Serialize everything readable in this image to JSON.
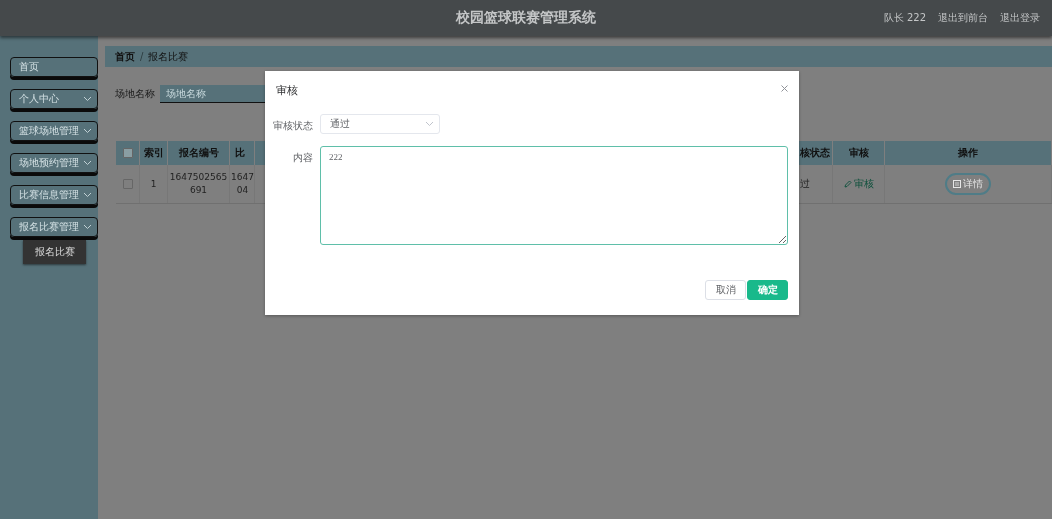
{
  "header": {
    "title": "校园篮球联赛管理系统",
    "user": "队长 222",
    "links": [
      "退出到前台",
      "退出登录"
    ]
  },
  "sidebar": {
    "items": [
      {
        "label": "首页",
        "kind": "link"
      },
      {
        "label": "个人中心",
        "kind": "menu"
      },
      {
        "label": "篮球场地管理",
        "kind": "menu"
      },
      {
        "label": "场地预约管理",
        "kind": "menu"
      },
      {
        "label": "比赛信息管理",
        "kind": "menu"
      },
      {
        "label": "报名比赛管理",
        "kind": "menu",
        "children": [
          {
            "label": "报名比赛",
            "selected": true
          }
        ]
      }
    ]
  },
  "breadcrumb": {
    "separator": "/",
    "items": [
      "首页",
      "报名比赛"
    ]
  },
  "search": {
    "label": "场地名称",
    "placeholder": "场地名称"
  },
  "table": {
    "columns": [
      {
        "kind": "checkbox",
        "checked": false
      },
      {
        "kind": "text",
        "label": "索引"
      },
      {
        "kind": "text",
        "label": "报名编号"
      },
      {
        "kind": "text",
        "label": "比"
      },
      {
        "kind": "text",
        "label": "核状态"
      },
      {
        "kind": "text",
        "label": "审核"
      },
      {
        "kind": "text",
        "label": "操作"
      }
    ],
    "rows": [
      {
        "cells": [
          {
            "kind": "checkbox",
            "checked": false
          },
          {
            "kind": "text",
            "text": "1"
          },
          {
            "kind": "text",
            "text": "1647502565691"
          },
          {
            "kind": "text",
            "text": "1647\n04"
          },
          {
            "kind": "text",
            "text": "过"
          },
          {
            "kind": "link",
            "text": "审核"
          },
          {
            "kind": "button",
            "text": "详情"
          }
        ]
      }
    ]
  },
  "dialog": {
    "title": "审核",
    "fields": [
      {
        "kind": "select",
        "label": "审核状态",
        "value": "通过"
      },
      {
        "kind": "textarea",
        "label": "内容",
        "value": "222",
        "focused": true
      }
    ],
    "buttons": [
      {
        "label": "取消",
        "kind": "secondary"
      },
      {
        "label": "确定",
        "kind": "primary"
      }
    ]
  }
}
